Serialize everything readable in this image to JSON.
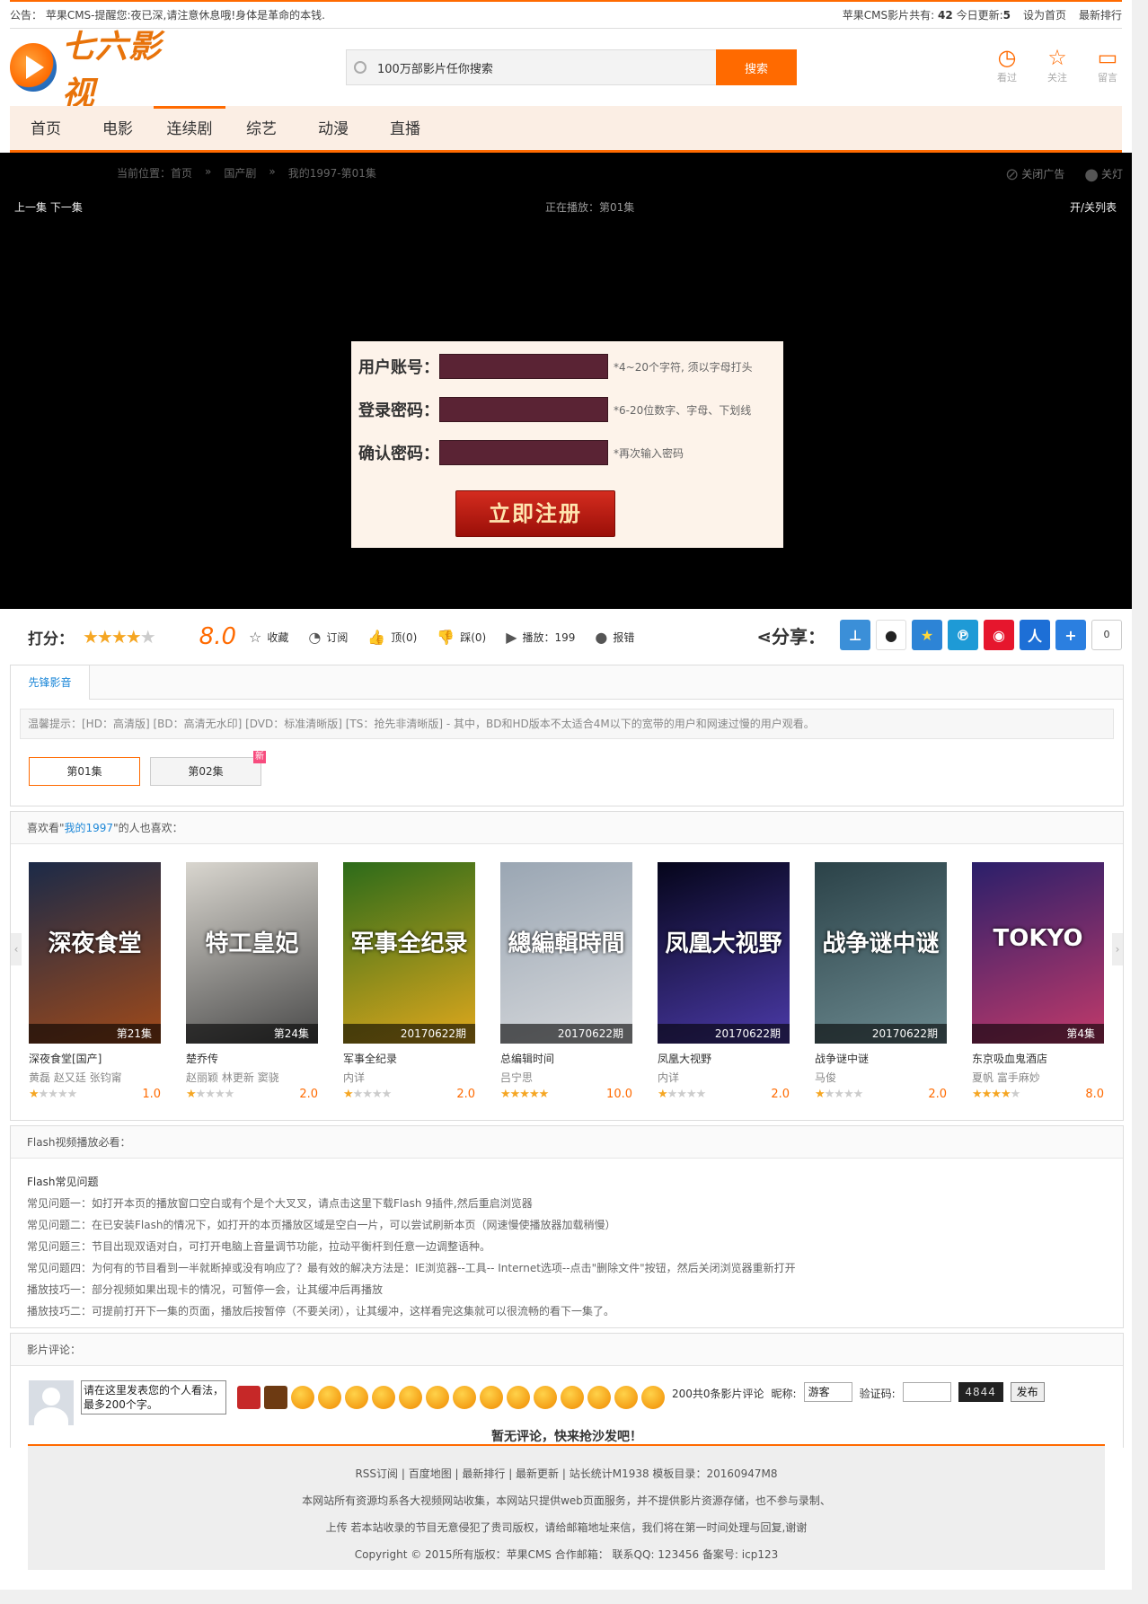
{
  "topbar": {
    "notice": "公告： 苹果CMS-提醒您:夜已深,请注意休息哦!身体是革命的本钱.",
    "stats_prefix": "苹果CMS影片共有:",
    "total": "42",
    "today_label": "今日更新:",
    "today": "5",
    "set_home": "设为首页",
    "latest_rank": "最新排行"
  },
  "logo": {
    "text": "七六影视"
  },
  "search": {
    "placeholder": "100万部影片任你搜索",
    "button": "搜索"
  },
  "header_icons": [
    {
      "icon": "history-icon",
      "label": "看过"
    },
    {
      "icon": "star-icon",
      "label": "关注"
    },
    {
      "icon": "message-icon",
      "label": "留言"
    }
  ],
  "nav": [
    "首页",
    "电影",
    "连续剧",
    "综艺",
    "动漫",
    "直播"
  ],
  "nav_active": 2,
  "breadcrumb": {
    "prefix": "当前位置：",
    "home": "首页",
    "sep": "»",
    "category": "国产剧",
    "current": "我的1997-第01集"
  },
  "ad_controls": {
    "close_ad": "关闭广告",
    "light_off": "关灯"
  },
  "player": {
    "prev_next": "上一集 下一集",
    "now_playing": "正在播放：第01集",
    "toggle_list": "开/关列表"
  },
  "register": {
    "user_label": "用户账号：",
    "user_tip": "*4~20个字符, 须以字母打头",
    "pass_label": "登录密码：",
    "pass_tip": "*6-20位数字、字母、下划线",
    "confirm_label": "确认密码：",
    "confirm_tip": "*再次输入密码",
    "submit": "立即注册"
  },
  "rating": {
    "label": "打分：",
    "stars": 4,
    "score": "8.0",
    "fav": "收藏",
    "subscribe": "订阅",
    "up": "顶(0)",
    "down": "踩(0)",
    "plays": "播放：199",
    "report": "报错",
    "share_label": "分享：",
    "share_count": "0"
  },
  "episodes": {
    "source_tab": "先锋影音",
    "tip": "温馨提示：[HD：高清版] [BD：高清无水印] [DVD：标准清晰版] [TS：抢先非清晰版] - 其中，BD和HD版本不太适合4M以下的宽带的用户和网速过慢的用户观看。",
    "list": [
      {
        "label": "第01集",
        "active": true
      },
      {
        "label": "第02集",
        "new": "新"
      }
    ]
  },
  "related": {
    "title_prefix": "喜欢看\"",
    "title_link": "我的1997",
    "title_suffix": "\"的人也喜欢：",
    "movies": [
      {
        "name": "深夜食堂[国产]",
        "actors": "黄磊 赵又廷 张钧甯",
        "badge": "第21集",
        "stars": 1,
        "score": "1.0",
        "poster_text": "深夜食堂",
        "colors": [
          "#1b2a48",
          "#a04a1a"
        ]
      },
      {
        "name": "楚乔传",
        "actors": "赵丽颖 林更新 窦骁",
        "badge": "第24集",
        "stars": 1,
        "score": "2.0",
        "poster_text": "特工皇妃",
        "colors": [
          "#d9d6cf",
          "#4a4a4a"
        ]
      },
      {
        "name": "军事全纪录",
        "actors": "内详",
        "badge": "20170622期",
        "stars": 1,
        "score": "2.0",
        "poster_text": "军事全纪录",
        "colors": [
          "#2c6b1a",
          "#e0a81c"
        ]
      },
      {
        "name": "总编辑时间",
        "actors": "吕宁思",
        "badge": "20170622期",
        "stars": 5,
        "score": "10.0",
        "poster_text": "總編輯時間",
        "colors": [
          "#9aa6b3",
          "#d7d9dc"
        ]
      },
      {
        "name": "凤凰大视野",
        "actors": "内详",
        "badge": "20170622期",
        "stars": 1,
        "score": "2.0",
        "poster_text": "凤凰大视野",
        "colors": [
          "#05051a",
          "#4b3aa8"
        ]
      },
      {
        "name": "战争谜中谜",
        "actors": "马俊",
        "badge": "20170622期",
        "stars": 1,
        "score": "2.0",
        "poster_text": "战争谜中谜",
        "colors": [
          "#2b4248",
          "#6c8a90"
        ]
      },
      {
        "name": "东京吸血鬼酒店",
        "actors": "夏帆 富手麻妙",
        "badge": "第4集",
        "stars": 4,
        "score": "8.0",
        "poster_text": "TOKYO",
        "colors": [
          "#2a1f6a",
          "#c23a6a"
        ]
      }
    ]
  },
  "faq": {
    "title": "Flash视频播放必看：",
    "head": "Flash常见问题",
    "items": [
      "常见问题一：如打开本页的播放窗口空白或有个是个大叉叉，请点击这里下载Flash 9插件,然后重启浏览器",
      "常见问题二：在已安装Flash的情况下，如打开的本页播放区域是空白一片，可以尝试刷新本页（网速慢使播放器加载稍慢）",
      "常见问题三：节目出现双语对白，可打开电脑上音量调节功能，拉动平衡杆到任意一边调整语种。",
      "常见问题四：为何有的节目看到一半就断掉或没有响应了？最有效的解决方法是：IE浏览器--工具-- Internet选项--点击\"删除文件\"按钮，然后关闭浏览器重新打开",
      "播放技巧一：部分视频如果出现卡的情况，可暂停一会，让其缓冲后再播放",
      "播放技巧二：可提前打开下一集的页面，播放后按暂停（不要关闭），让其缓冲，这样看完这集就可以很流畅的看下一集了。"
    ]
  },
  "comments": {
    "title": "影片评论：",
    "textarea": "请在这里发表您的个人看法，最多200个字。",
    "counter": "200共0条影片评论",
    "nick_label": "昵称:",
    "nick_value": "游客",
    "captcha_label": "验证码:",
    "captcha_img": "4844",
    "submit": "发布",
    "empty": "暂无评论，快来抢沙发吧！"
  },
  "footer": {
    "links": "RSS订阅 | 百度地图 | 最新排行 | 最新更新 | 站长统计M1938 模板目录：20160947M8",
    "line1": "本网站所有资源均系各大视频网站收集，本网站只提供web页面服务，并不提供影片资源存储，也不参与录制、",
    "line2": "上传 若本站收录的节目无意侵犯了贵司版权，请给邮箱地址来信，我们将在第一时间处理与回复,谢谢",
    "copyright": "Copyright © 2015所有版权：苹果CMS 合作邮箱： 联系QQ: 123456 备案号: icp123"
  }
}
